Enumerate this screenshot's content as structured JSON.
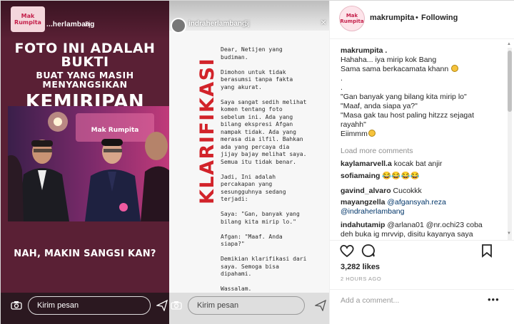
{
  "left_story": {
    "logo_text": "Mak Rumpita",
    "username": "...herlambang",
    "time": "8j",
    "headline_line1": "FOTO INI ADALAH BUKTI",
    "headline_line2": "BUAT YANG MASIH MENYANGSIKAN",
    "headline_line3": "KEMIRIPAN KAMI",
    "photo_banner": "Mak Rumpita",
    "caption": "NAH, MAKIN SANGSI KAN?",
    "reply_placeholder": "Kirim pesan"
  },
  "middle_story": {
    "username": "indraherlambang",
    "time": "5j",
    "close": "×",
    "vertical_title": "KLARIFIKASI",
    "body": "Dear, Netijen yang\nbudiman.\n\nDimohon untuk tidak\nberasumsi tanpa fakta\nyang akurat.\n\nSaya sangat sedih melihat\nkomen tentang foto\nsebelum ini. Ada yang\nbilang ekspresi Afgan\nnampak tidak. Ada yang\nmerasa dia ilfil. Bahkan\nada yang percaya dia\njijay bajay melihat saya.\nSemua itu tidak benar.\n\nJadi, Ini adalah\npercakapan yang\nsesungguhnya sedang\nterjadi:\n\nSaya: \"Gan, banyak yang\nbilang kita mirip lo.\"\n\nAfgan: \"Maaf. Anda\nsiapa?\"\n\nDemikian klarifikasi dari\nsaya. Semoga bisa\ndipahami.\n\nWassalam.",
    "reply_placeholder": "Kirim pesan"
  },
  "panel": {
    "header": {
      "avatar_text": "Mak Rumpita",
      "username": "makrumpita",
      "dot": "•",
      "follow_status": "Following"
    },
    "caption": {
      "username": "makrumpita .",
      "lines": [
        "Hahaha... iya mirip kok Bang",
        "Sama sama berkacamata khann",
        ".",
        ".",
        "\"Gan banyak yang bilang kita mirip lo\"",
        "\"Maaf, anda siapa ya?\"",
        "\"Masa gak tau host paling hitzzz sejagat",
        "rayahh\"",
        "Eiimmm"
      ]
    },
    "load_more": "Load more comments",
    "comments": [
      {
        "user": "kaylamarvell.a",
        "text": " kocak bat anjir"
      },
      {
        "user": "sofiamaing",
        "text": " 😂😂😂😂"
      },
      {
        "user": "gavind_alvaro",
        "text": " Cucokkk"
      },
      {
        "user": "mayangzella",
        "text": " @afgansyah.reza",
        "text2": "@indraherlambang"
      },
      {
        "user": "indahutamip",
        "text": " @arlana01 @nr.ochi23 coba",
        "text2": "deh buka ig mrvvip, disitu kayanya saya"
      }
    ],
    "likes": "3,282 likes",
    "time_ago": "2 HOURS AGO",
    "add_comment_placeholder": "Add a comment...",
    "more_label": "•••"
  },
  "colors": {
    "story_bg": "#5a2035",
    "link": "#003569",
    "klarifikasi_red": "#d2232a"
  }
}
